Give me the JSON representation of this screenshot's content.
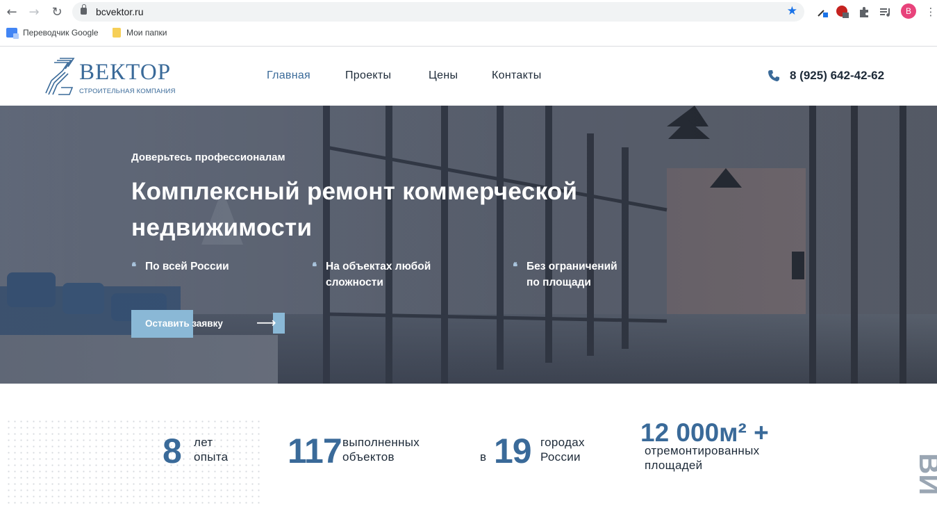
{
  "browser": {
    "url": "bcvektor.ru",
    "bookmarks": [
      {
        "label": "Переводчик Google",
        "icon": "google-translate-icon"
      },
      {
        "label": "Мои папки",
        "icon": "folder-icon"
      }
    ],
    "profile_initial": "В",
    "icons": {
      "back": "arrow-left-icon",
      "forward": "arrow-right-icon",
      "reload": "reload-icon",
      "star": "star-icon",
      "extensions": "puzzle-icon",
      "media": "media-list-icon",
      "menu": "kebab-menu-icon"
    }
  },
  "site": {
    "logo": {
      "word": "ВЕКТОР",
      "subtitle": "СТРОИТЕЛЬНАЯ КОМПАНИЯ"
    },
    "nav": [
      {
        "label": "Главная",
        "active": true
      },
      {
        "label": "Проекты",
        "active": false
      },
      {
        "label": "Цены",
        "active": false
      },
      {
        "label": "Контакты",
        "active": false
      }
    ],
    "phone": "8 (925) 642-42-62",
    "accent": "#3a6a99",
    "button_color": "#8ab8d6"
  },
  "hero": {
    "kicker": "Доверьтесь профессионалам",
    "headline": "Комплексный ремонт коммерческой недвижимости",
    "features": [
      {
        "line1": "По всей России",
        "line2": ""
      },
      {
        "line1": "На объектах любой",
        "line2": "сложности"
      },
      {
        "line1": "Без ограничений",
        "line2": "по площади"
      }
    ],
    "cta_label": "Оставить заявку"
  },
  "stats": [
    {
      "prefix": "",
      "number": "8",
      "line1": "лет",
      "line2": "опыта"
    },
    {
      "prefix": "",
      "number": "117",
      "line1": "выполненных",
      "line2": "объектов"
    },
    {
      "prefix": "в",
      "number": "19",
      "line1": "городах",
      "line2": "России"
    },
    {
      "prefix": "",
      "number": "12 000м² +",
      "line1": "отремонтированных",
      "line2": "площадей"
    }
  ],
  "side_text": "ВИ"
}
